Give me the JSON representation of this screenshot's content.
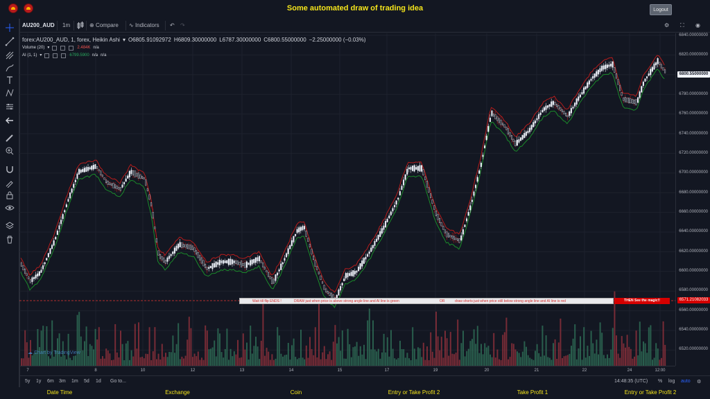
{
  "page": {
    "title": "Some automated draw of trading idea",
    "logout_label": "Logout"
  },
  "toolbar": {
    "symbol": "AU200_AUD",
    "interval": "1m",
    "compare_label": "Compare",
    "indicators_label": "Indicators"
  },
  "legend": {
    "main": "forex:AU200_AUD, 1, forex, Heikin Ashi",
    "o": "O6805.91092972",
    "h": "H6809.30000000",
    "l": "L6787.30000000",
    "c": "C6800.55000000",
    "chg": "−2.25000000 (−0.03%)",
    "volume_label": "Volume (20)",
    "volume_value": "2.484K",
    "volume_na": "n/a",
    "ai_label": "AI (1, 1)",
    "ai_value": "6799.5900",
    "ai_na1": "n/a",
    "ai_na2": "n/a"
  },
  "price_axis": {
    "ticks": [
      "6840.00000000",
      "6820.00000000",
      "6780.00000000",
      "6760.00000000",
      "6740.00000000",
      "6720.00000000",
      "6700.00000000",
      "6680.00000000",
      "6660.00000000",
      "6640.00000000",
      "6620.00000000",
      "6600.00000000",
      "6580.00000000",
      "6560.00000000",
      "6540.00000000",
      "6520.00000000"
    ],
    "current_price": "6800.55000000",
    "line_price": "6571.21082033"
  },
  "time_axis": {
    "ticks": [
      "7",
      "8",
      "10",
      "12",
      "13",
      "14",
      "15",
      "17",
      "19",
      "20",
      "21",
      "22",
      "24",
      "12:00"
    ]
  },
  "range_bar": {
    "ranges": [
      "5y",
      "1y",
      "6m",
      "3m",
      "1m",
      "5d",
      "1d"
    ],
    "goto": "Go to...",
    "clock": "14:48:35 (UTC)",
    "pct": "%",
    "log": "log",
    "auto": "auto"
  },
  "annotation": {
    "t1": "Wait till flip ENDS  !",
    "t2": "DRAW just when price is above strong angle line and AI line is green",
    "t3": "OR",
    "t4": "draw shorts just when price still below strong angle line and AI line is red",
    "magic": "THEN See the magic!!"
  },
  "watermark": "Chart by TradingView",
  "columns": [
    "Date Time",
    "Exchange",
    "Coin",
    "Entry or Take Profit 2",
    "Take Profit 1",
    "Entry or Take Profit 2"
  ],
  "colors": {
    "accent": "#f5e51b",
    "up": "#26a69a",
    "down": "#ef5350",
    "ai_green": "#1b8a2a",
    "ai_red": "#b71c1c",
    "background": "#131722"
  }
}
